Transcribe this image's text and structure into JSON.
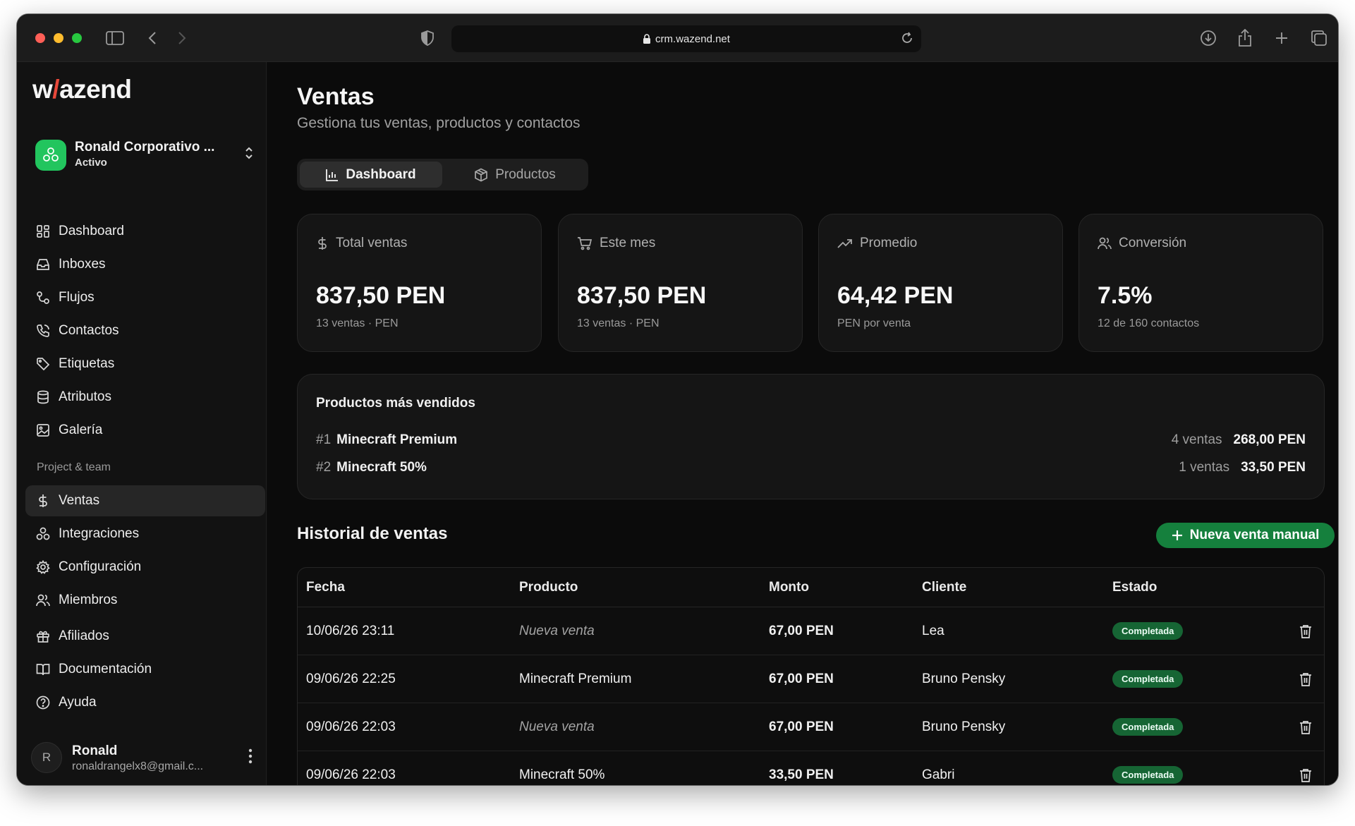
{
  "browser": {
    "url": "crm.wazend.net"
  },
  "sidebar": {
    "logo": {
      "pre": "w",
      "bolt": "/",
      "post": "azend"
    },
    "org": {
      "name": "Ronald Corporativo ...",
      "status": "Activo"
    },
    "items": [
      {
        "label": "Dashboard",
        "icon": "dashboard-icon"
      },
      {
        "label": "Inboxes",
        "icon": "inbox-icon"
      },
      {
        "label": "Flujos",
        "icon": "flow-icon"
      },
      {
        "label": "Contactos",
        "icon": "phone-icon"
      },
      {
        "label": "Etiquetas",
        "icon": "tag-icon"
      },
      {
        "label": "Atributos",
        "icon": "database-icon"
      },
      {
        "label": "Galería",
        "icon": "image-icon"
      }
    ],
    "section_label": "Project & team",
    "team_items": [
      {
        "label": "Ventas",
        "icon": "dollar-icon",
        "active": true
      },
      {
        "label": "Integraciones",
        "icon": "integrations-icon"
      },
      {
        "label": "Configuración",
        "icon": "gear-icon"
      },
      {
        "label": "Miembros",
        "icon": "users-icon"
      },
      {
        "label": "Afiliados",
        "icon": "gift-icon"
      },
      {
        "label": "Documentación",
        "icon": "book-icon"
      },
      {
        "label": "Ayuda",
        "icon": "help-icon"
      }
    ],
    "user": {
      "initial": "R",
      "name": "Ronald",
      "email": "ronaldrangelx8@gmail.c..."
    }
  },
  "page": {
    "title": "Ventas",
    "subtitle": "Gestiona tus ventas, productos y contactos",
    "tabs": [
      {
        "label": "Dashboard",
        "active": true
      },
      {
        "label": "Productos",
        "active": false
      }
    ]
  },
  "stats": [
    {
      "label": "Total ventas",
      "value": "837,50 PEN",
      "sub": "13 ventas · PEN",
      "icon": "dollar-icon"
    },
    {
      "label": "Este mes",
      "value": "837,50 PEN",
      "sub": "13 ventas · PEN",
      "icon": "cart-icon"
    },
    {
      "label": "Promedio",
      "value": "64,42 PEN",
      "sub": "PEN por venta",
      "icon": "trending-up-icon"
    },
    {
      "label": "Conversión",
      "value": "7.5%",
      "sub": "12 de 160 contactos",
      "icon": "users-icon"
    }
  ],
  "top_products": {
    "title": "Productos más vendidos",
    "rows": [
      {
        "rank": "#1",
        "name": "Minecraft Premium",
        "count": "4 ventas",
        "amount": "268,00 PEN"
      },
      {
        "rank": "#2",
        "name": "Minecraft 50%",
        "count": "1 ventas",
        "amount": "33,50 PEN"
      }
    ]
  },
  "history": {
    "title": "Historial de ventas",
    "new_button": "Nueva venta manual",
    "columns": [
      "Fecha",
      "Producto",
      "Monto",
      "Cliente",
      "Estado"
    ],
    "rows": [
      {
        "fecha": "10/06/26 23:11",
        "producto": "Nueva venta",
        "placeholder": true,
        "monto": "67,00 PEN",
        "cliente": "Lea",
        "estado": "Completada"
      },
      {
        "fecha": "09/06/26 22:25",
        "producto": "Minecraft Premium",
        "placeholder": false,
        "monto": "67,00 PEN",
        "cliente": "Bruno Pensky",
        "estado": "Completada"
      },
      {
        "fecha": "09/06/26 22:03",
        "producto": "Nueva venta",
        "placeholder": true,
        "monto": "67,00 PEN",
        "cliente": "Bruno Pensky",
        "estado": "Completada"
      },
      {
        "fecha": "09/06/26 22:03",
        "producto": "Minecraft 50%",
        "placeholder": false,
        "monto": "33,50 PEN",
        "cliente": "Gabri",
        "estado": "Completada"
      }
    ]
  },
  "colors": {
    "accent_green": "#15803d",
    "badge_green": "#166534",
    "logo_bolt": "#e8483a",
    "org_avatar": "#22c55e"
  }
}
